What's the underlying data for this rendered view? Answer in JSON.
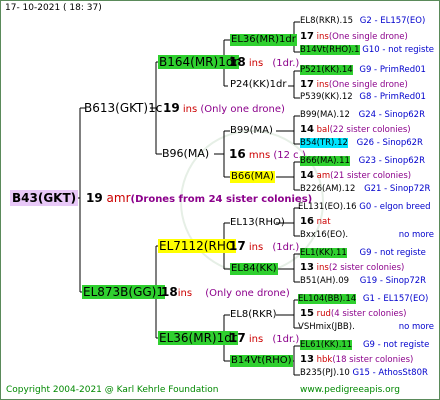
{
  "header": {
    "date": "17- 10-2021 ( 18: 37)"
  },
  "footer": {
    "copyright": "Copyright 2004-2021 @ Karl Kehrle Foundation",
    "website": "www.pedigreeapis.org"
  },
  "colors": {
    "green_box": "#2fd02f",
    "yellow_box": "#ffff00",
    "cyan_box": "#00e5ff",
    "root_box": "#e8c8f8",
    "red_text": "#cc0000",
    "blue_text": "#0000cc",
    "violet_text": "#8b008b"
  },
  "root": {
    "name": "B43(GKT)",
    "num": "19",
    "sfx": "amr",
    "note": "(Drones from 24 sister colonies)"
  },
  "gen1": [
    {
      "name": "B613(GKT)1c",
      "num": "19",
      "sfx": "ins",
      "note": "(Only one drone)"
    },
    {
      "name": "EL873B(GG)1",
      "num": "18",
      "sfx": "ins",
      "note": "(Only one drone)"
    }
  ],
  "gen2": [
    {
      "name": "B164(MR)1dr",
      "num": "18",
      "sfx": "ins",
      "note": "(1dr.)"
    },
    {
      "name": "B96(MA)",
      "num": "16",
      "sfx": "mns",
      "note": "(12 c.)"
    },
    {
      "name": "EL7112(RHO",
      "num": "17",
      "sfx": "ins",
      "note": "(1dr.)"
    },
    {
      "name": "EL36(MR)1dr",
      "num": "17",
      "sfx": "ins",
      "note": "(1dr.)"
    }
  ],
  "gen3": [
    {
      "name": "EL36(MR)1dr"
    },
    {
      "name": "P24(KK)1dr"
    },
    {
      "name": "B99(MA)"
    },
    {
      "name": "B66(MA)"
    },
    {
      "name": "EL13(RHO)"
    },
    {
      "name": "EL84(KK)"
    },
    {
      "name": "EL8(RKR)"
    },
    {
      "name": "B14Vt(RHO)"
    }
  ],
  "gen4": [
    {
      "name": "EL8(RKR).15",
      "info": "G2 - EL157(EO)"
    },
    {
      "num": "17",
      "sfx": "ins",
      "note": "(One single drone)"
    },
    {
      "name": "B14Vt(RHO).1",
      "info": "G10 - not registe"
    },
    {
      "name": "P521(KK).14",
      "info": "G9 - PrimRed01"
    },
    {
      "num": "17",
      "sfx": "ins",
      "note": "(One single drone)"
    },
    {
      "name": "P539(KK).12",
      "info": "G8 - PrimRed01"
    },
    {
      "name": "B99(MA).12",
      "info": "G24 - Sinop62R"
    },
    {
      "num": "14",
      "sfx": "bal",
      "note": "(22 sister colonies)"
    },
    {
      "name": "B54(TR).12",
      "info": "G26 - Sinop62R"
    },
    {
      "name": "B66(MA).11",
      "info": "G23 - Sinop62R"
    },
    {
      "num": "14",
      "sfx": "am",
      "note": "(21 sister colonies)"
    },
    {
      "name": "B226(AM).12",
      "info": "G21 - Sinop72R"
    },
    {
      "name": "EL131(EO).16",
      "info": "G0 - elgon breed"
    },
    {
      "num": "16",
      "sfx": "nat",
      "note": ""
    },
    {
      "name": "Bxx16(EO).",
      "info": "no more"
    },
    {
      "name": "EL1(KK).11",
      "info": "G9 - not registe"
    },
    {
      "num": "13",
      "sfx": "ins",
      "note": "(2 sister colonies)"
    },
    {
      "name": "B51(AH).09",
      "info": "G19 - Sinop72R"
    },
    {
      "name": "EL104(BB).14",
      "info": "G1 - EL157(EO)"
    },
    {
      "num": "15",
      "sfx": "rud",
      "note": "(4 sister colonies)"
    },
    {
      "name": "VSHmix(JBB).",
      "info": "no more"
    },
    {
      "name": "EL61(KK).11",
      "info": "G9 - not registe"
    },
    {
      "num": "13",
      "sfx": "hbk",
      "note": "(18 sister colonies)"
    },
    {
      "name": "B235(PJ).10",
      "info": "G15 - AthosSt80R"
    }
  ]
}
